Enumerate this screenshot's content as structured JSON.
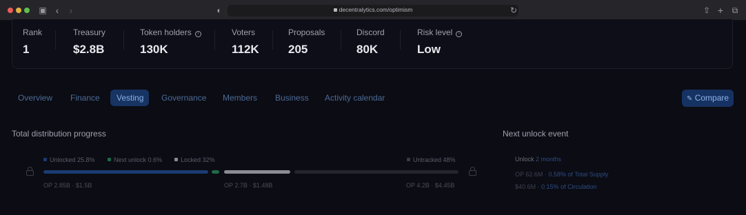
{
  "browser": {
    "url": "decentralytics.com/optimism"
  },
  "stats": [
    {
      "label": "Rank",
      "value": "1",
      "info": false
    },
    {
      "label": "Treasury",
      "value": "$2.8B",
      "info": false
    },
    {
      "label": "Token holders",
      "value": "130K",
      "info": true
    },
    {
      "label": "Voters",
      "value": "112K",
      "info": false
    },
    {
      "label": "Proposals",
      "value": "205",
      "info": false
    },
    {
      "label": "Discord",
      "value": "80K",
      "info": false
    },
    {
      "label": "Risk level",
      "value": "Low",
      "info": true
    }
  ],
  "tabs": [
    {
      "label": "Overview",
      "active": false
    },
    {
      "label": "Finance",
      "active": false
    },
    {
      "label": "Vesting",
      "active": true
    },
    {
      "label": "Governance",
      "active": false
    },
    {
      "label": "Members",
      "active": false
    },
    {
      "label": "Business",
      "active": false
    },
    {
      "label": "Activity calendar",
      "active": false
    }
  ],
  "compare_button": "Compare",
  "distribution": {
    "title": "Total distribution progress",
    "legend": {
      "unlocked": "Unlocked 25.8%",
      "next_unlock": "Next unlock 0.6%",
      "locked": "Locked 32%",
      "untracked": "Untracked 48%"
    },
    "colors": {
      "unlocked": "#1c3b73",
      "next_unlock": "#1e6a4a",
      "locked": "#8a8c93",
      "untracked": "#24262d"
    },
    "labels": {
      "unlocked": "OP 2.85B · $1.5B",
      "locked": "OP 2.7B · $1.48B",
      "untracked": "OP 4.2B · $4.45B"
    }
  },
  "next_unlock": {
    "title": "Next unlock event",
    "unlock_label": "Unlock",
    "unlock_in": "2 months",
    "amount": "OP 62.6M",
    "amount_note": "· 0.58% of Total Supply",
    "value": "$40.6M",
    "value_note": "· 0.15% of Circulation"
  }
}
